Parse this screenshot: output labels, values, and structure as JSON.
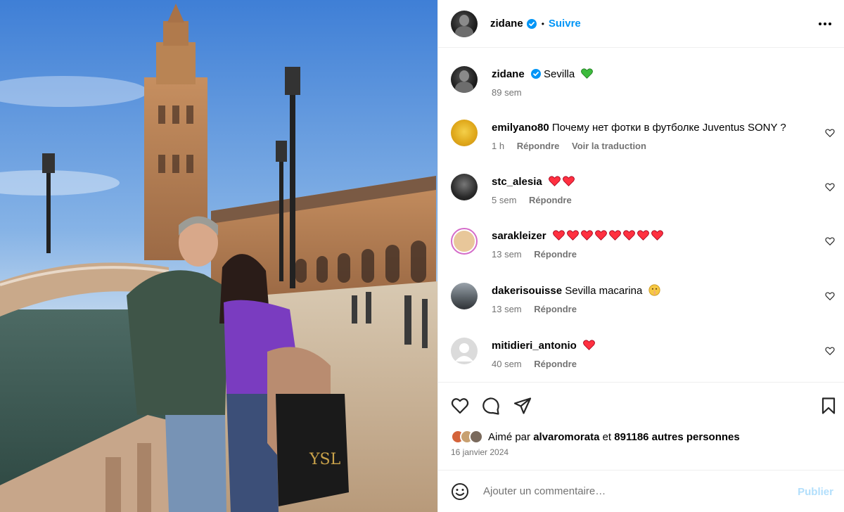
{
  "post": {
    "author": "zidane",
    "follow_label": "Suivre",
    "dot": "•"
  },
  "caption": {
    "username": "zidane",
    "text": "Sevilla",
    "emoji": "green-heart",
    "time": "89 sem"
  },
  "comments": [
    {
      "username": "emilyano80",
      "text": "Почему нет фотки в футболке Juventus SONY ?",
      "time": "1 h",
      "reply": "Répondre",
      "translate": "Voir la traduction",
      "hearts": 0,
      "emoji": ""
    },
    {
      "username": "stc_alesia",
      "text": "",
      "time": "5 sem",
      "reply": "Répondre",
      "translate": "",
      "hearts": 2,
      "emoji": ""
    },
    {
      "username": "sarakleizer",
      "text": "",
      "time": "13 sem",
      "reply": "Répondre",
      "translate": "",
      "hearts": 8,
      "emoji": ""
    },
    {
      "username": "dakerisouisse",
      "text": "Sevilla macarina",
      "time": "13 sem",
      "reply": "Répondre",
      "translate": "",
      "hearts": 0,
      "emoji": "shushing-face"
    },
    {
      "username": "mitidieri_antonio",
      "text": "",
      "time": "40 sem",
      "reply": "Répondre",
      "translate": "",
      "hearts": 1,
      "emoji": ""
    }
  ],
  "likes": {
    "prefix": "Aimé par",
    "user": "alvaromorata",
    "middle": "et",
    "count_text": "891186 autres personnes"
  },
  "date": "16 janvier 2024",
  "composer": {
    "placeholder": "Ajouter un commentaire…",
    "publish_label": "Publier"
  },
  "colors": {
    "accent": "#0095f6",
    "publish_disabled": "#b2dffc",
    "muted": "#737373",
    "heart_red": "#ff3040",
    "heart_green": "#3dbb3d"
  }
}
